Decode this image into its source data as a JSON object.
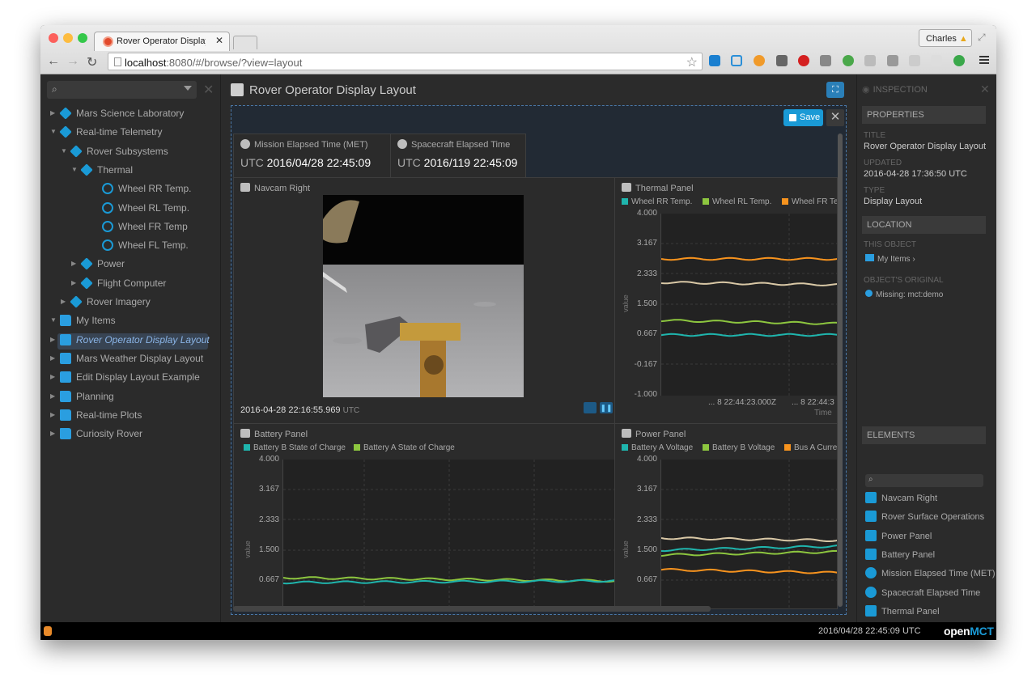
{
  "browser": {
    "tab_title": "Rover Operator Display Layout",
    "user": "Charles",
    "url_host": "localhost",
    "url_rest": ":8080/#/browse/?view=layout"
  },
  "tree": {
    "items": [
      {
        "label": "Mars Science Laboratory",
        "icon": "cube-icon"
      },
      {
        "label": "Real-time Telemetry",
        "icon": "cube-icon"
      },
      {
        "label": "Rover Subsystems",
        "icon": "cube-icon"
      },
      {
        "label": "Thermal",
        "icon": "cube-icon"
      },
      {
        "label": "Wheel RR Temp.",
        "icon": "sensor-icon"
      },
      {
        "label": "Wheel RL Temp.",
        "icon": "sensor-icon"
      },
      {
        "label": "Wheel FR Temp",
        "icon": "sensor-icon"
      },
      {
        "label": "Wheel FL Temp.",
        "icon": "sensor-icon"
      },
      {
        "label": "Power",
        "icon": "cube-icon"
      },
      {
        "label": "Flight Computer",
        "icon": "cube-icon"
      },
      {
        "label": "Rover Imagery",
        "icon": "cube-icon"
      },
      {
        "label": "My Items",
        "icon": "folder-icon"
      },
      {
        "label": "Rover Operator Display Layout",
        "icon": "layout-icon"
      },
      {
        "label": "Mars Weather Display Layout",
        "icon": "layout-icon"
      },
      {
        "label": "Edit Display Layout Example",
        "icon": "layout-icon"
      },
      {
        "label": "Planning",
        "icon": "folder-icon"
      },
      {
        "label": "Real-time Plots",
        "icon": "folder-icon"
      },
      {
        "label": "Curiosity Rover",
        "icon": "folder-icon"
      }
    ]
  },
  "main": {
    "title": "Rover Operator Display Layout",
    "save_label": "Save",
    "met": {
      "title": "Mission Elapsed Time (MET)",
      "prefix": "UTC",
      "value": "2016/04/28 22:45:09"
    },
    "set": {
      "title": "Spacecraft Elapsed Time",
      "prefix": "UTC",
      "value": "2016/119 22:45:09"
    },
    "navcam": {
      "title": "Navcam Right",
      "timestamp": "2016-04-28 22:16:55.969",
      "tz": "UTC"
    },
    "thermal": {
      "title": "Thermal Panel",
      "legend": [
        "Wheel RR Temp.",
        "Wheel RL Temp.",
        "Wheel FR Ter"
      ],
      "yticks": [
        "4.000",
        "3.167",
        "2.333",
        "1.500",
        "0.667",
        "-0.167",
        "-1.000"
      ],
      "yaxis": "value",
      "xticks": [
        "... 8 22:44:23.000Z",
        "... 8 22:44:3"
      ],
      "xaxis": "Time"
    },
    "battery": {
      "title": "Battery Panel",
      "legend": [
        "Battery B State of Charge",
        "Battery A State of Charge"
      ],
      "yticks": [
        "4.000",
        "3.167",
        "2.333",
        "1.500",
        "0.667"
      ],
      "yaxis": "value"
    },
    "power": {
      "title": "Power Panel",
      "legend": [
        "Battery A Voltage",
        "Battery B Voltage",
        "Bus A Curre"
      ],
      "yticks": [
        "4.000",
        "3.167",
        "2.333",
        "1.500",
        "0.667"
      ],
      "yaxis": "value"
    }
  },
  "inspector": {
    "header": "INSPECTION",
    "properties": "PROPERTIES",
    "title_label": "TITLE",
    "title_value": "Rover Operator Display Layout",
    "updated_label": "UPDATED",
    "updated_value": "2016-04-28 17:36:50 UTC",
    "type_label": "TYPE",
    "type_value": "Display Layout",
    "location": "LOCATION",
    "this_object": "THIS OBJECT",
    "my_items": "My Items",
    "original": "OBJECT'S ORIGINAL",
    "missing": "Missing: mct:demo",
    "elements": "ELEMENTS",
    "element_items": [
      "Navcam Right",
      "Rover Surface Operations",
      "Power Panel",
      "Battery Panel",
      "Mission Elapsed Time (MET)",
      "Spacecraft Elapsed Time",
      "Thermal Panel"
    ]
  },
  "status": {
    "time": "2016/04/28 22:45:09 UTC",
    "logo_a": "open",
    "logo_b": "MCT"
  },
  "colors": {
    "teal": "#1fb5ad",
    "green": "#8dc63f",
    "orange": "#f7931e",
    "beige": "#d9c8a6",
    "accent": "#1a9ad6"
  }
}
